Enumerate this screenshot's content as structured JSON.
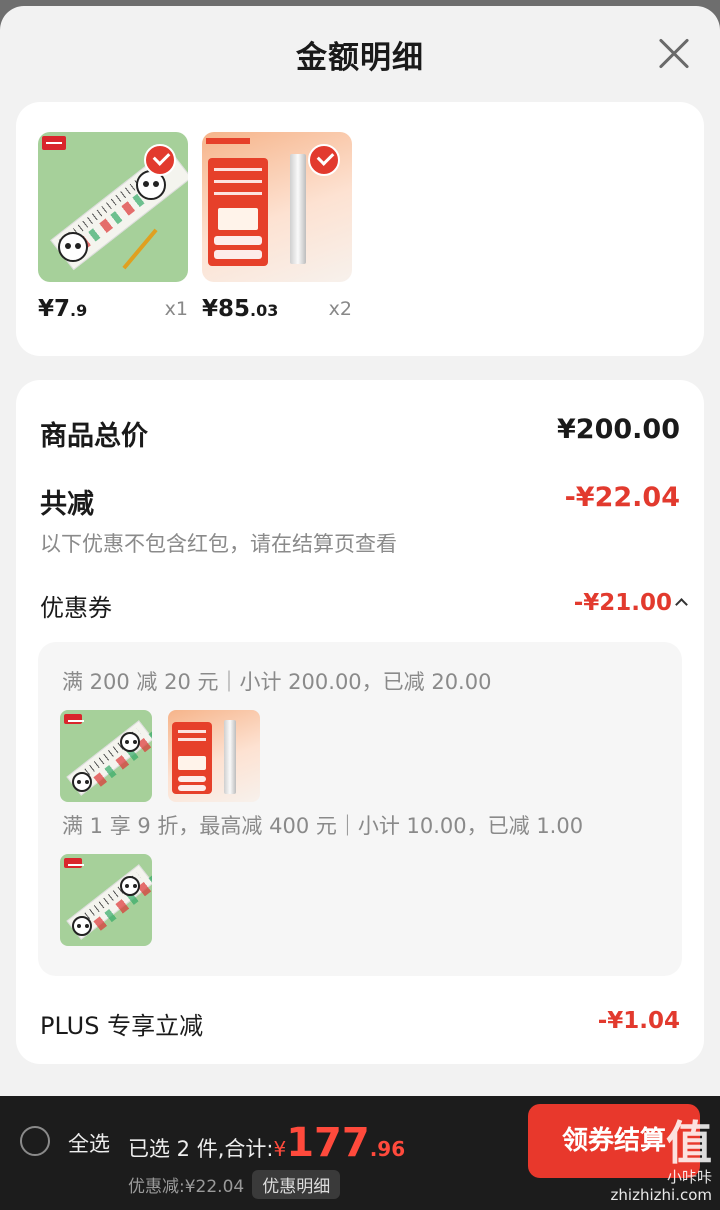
{
  "sheet": {
    "title": "金额明细"
  },
  "products": [
    {
      "price_int": "¥7",
      "price_dec": ".9",
      "qty": "x1"
    },
    {
      "price_int": "¥85",
      "price_dec": ".03",
      "qty": "x2"
    }
  ],
  "summary": {
    "total_label": "商品总价",
    "total_value": "¥200.00",
    "reduce_label": "共减",
    "reduce_value": "-¥22.04",
    "note": "以下优惠不包含红包，请在结算页查看",
    "coupon_label": "优惠券",
    "coupon_value": "-¥21.00",
    "coupons": [
      {
        "text": "满 200 减 20 元｜小计 200.00，已减 20.00"
      },
      {
        "text": "满 1 享 9 折，最高减 400 元｜小计 10.00，已减 1.00"
      }
    ],
    "plus_label": "PLUS 专享立减",
    "plus_value": "-¥1.04"
  },
  "bottom": {
    "select_all": "全选",
    "selected_text": "已选 2 件,合计:",
    "total_symbol": "¥",
    "total_int": "177",
    "total_dec": ".96",
    "discount_text": "优惠减:¥22.04",
    "detail_label": "优惠明细",
    "checkout_label": "领券结算"
  },
  "watermark": {
    "logo": "值",
    "site": "zhizhizhi.com",
    "tag": "小咔咔"
  },
  "colors": {
    "accent": "#e23a2e",
    "bar": "#1c1c1c",
    "sheet_bg": "#f2f2f2"
  }
}
